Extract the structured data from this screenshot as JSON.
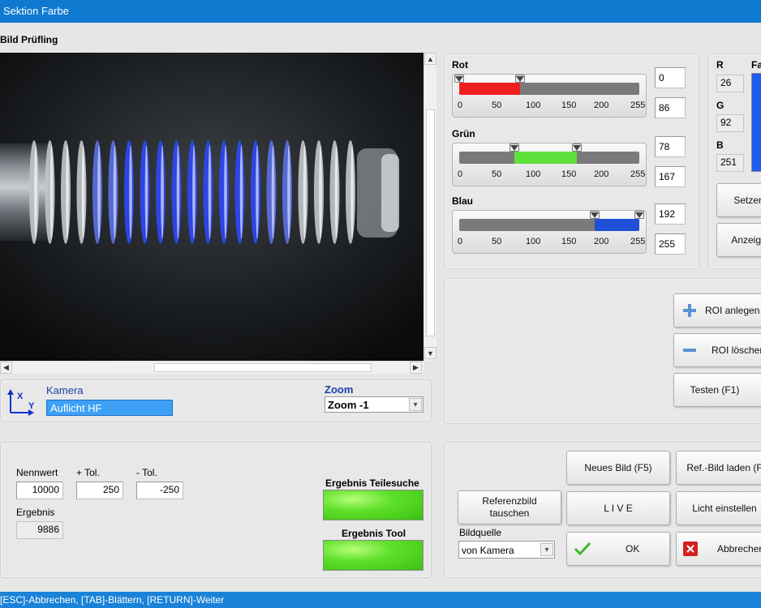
{
  "window": {
    "title": "Sektion Farbe"
  },
  "image_section": {
    "label": "Bild Prüfling"
  },
  "color_sliders": [
    {
      "label": "Rot",
      "min": 0,
      "max": 255,
      "low": 0,
      "high": 86,
      "low_text": "0",
      "high_text": "86",
      "color": "#f02020"
    },
    {
      "label": "Grün",
      "min": 0,
      "max": 255,
      "low": 78,
      "high": 167,
      "low_text": "78",
      "high_text": "167",
      "color": "#5fe03a"
    },
    {
      "label": "Blau",
      "min": 0,
      "max": 255,
      "low": 192,
      "high": 255,
      "low_text": "192",
      "high_text": "255",
      "color": "#1f4fd6"
    }
  ],
  "scale_ticks": [
    "0",
    "50",
    "100",
    "150",
    "200",
    "255"
  ],
  "rgb_readout": {
    "r_label": "R",
    "r_value": "26",
    "g_label": "G",
    "g_value": "92",
    "b_label": "B",
    "b_value": "251",
    "swatch_label": "Fa",
    "swatch_color": "#1f5cf0"
  },
  "color_buttons": {
    "set": "Setzen",
    "show": "Anzeige"
  },
  "roi": {
    "add": "ROI anlegen",
    "delete": "ROI löschen",
    "test": "Testen (F1)"
  },
  "camera": {
    "axis_x": "X",
    "axis_y": "Y",
    "label": "Kamera",
    "value": "Auflicht HF",
    "zoom_label": "Zoom",
    "zoom_value": "Zoom -1"
  },
  "measure": {
    "nominal_label": "Nennwert",
    "nominal_value": "10000",
    "plus_tol_label": "+ Tol.",
    "plus_tol_value": "250",
    "minus_tol_label": "- Tol.",
    "minus_tol_value": "-250",
    "result_label": "Ergebnis",
    "result_value": "9886"
  },
  "results": {
    "part_search": "Ergebnis Teilesuche",
    "tool": "Ergebnis Tool"
  },
  "actions": {
    "new_image": "Neues Bild (F5)",
    "load_ref": "Ref.-Bild laden (F",
    "swap_ref_line1": "Referenzbild",
    "swap_ref_line2": "tauschen",
    "live": "L I V E",
    "light": "Licht einstellen",
    "source_label": "Bildquelle",
    "source_value": "von Kamera",
    "ok": "OK",
    "cancel": "Abbrechen"
  },
  "status": {
    "text": "[ESC]-Abbrechen,  [TAB]-Blättern, [RETURN]-Weiter"
  }
}
